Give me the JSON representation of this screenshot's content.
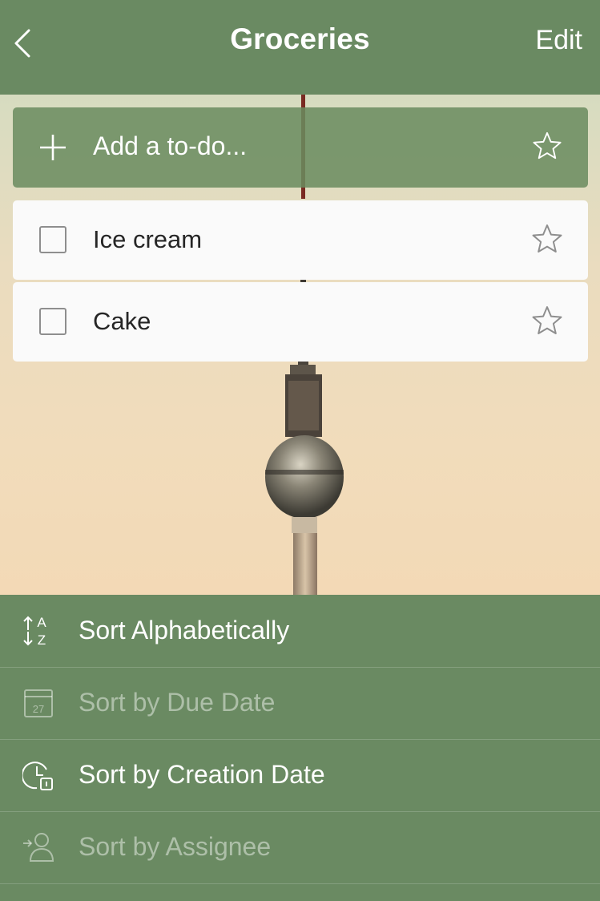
{
  "header": {
    "title": "Groceries",
    "edit_label": "Edit"
  },
  "add_bar": {
    "placeholder": "Add a to-do..."
  },
  "todos": [
    {
      "label": "Ice cream",
      "checked": false,
      "starred": false
    },
    {
      "label": "Cake",
      "checked": false,
      "starred": false
    }
  ],
  "sort_menu": {
    "items": [
      {
        "label": "Sort Alphabetically",
        "icon": "sort-az-icon",
        "enabled": true
      },
      {
        "label": "Sort by Due Date",
        "icon": "calendar-icon",
        "calendar_day": "27",
        "enabled": false
      },
      {
        "label": "Sort by Creation Date",
        "icon": "clock-calendar-icon",
        "enabled": true
      },
      {
        "label": "Sort by Assignee",
        "icon": "assignee-icon",
        "enabled": false
      }
    ]
  },
  "colors": {
    "brand_green": "#6a8a62",
    "item_bg": "#fafafa"
  }
}
